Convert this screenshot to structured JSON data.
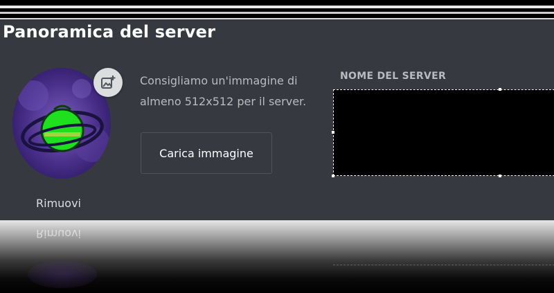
{
  "overview": {
    "title": "Panoramica del server",
    "icon_upload": {
      "remove_label": "Rimuovi",
      "hint_text": "Consigliamo un'immagine di almeno 512x512 per il server.",
      "upload_button_label": "Carica immagine"
    },
    "server_name": {
      "label": "NOME DEL SERVER",
      "value": ""
    },
    "reflection_text": "Rimuovi"
  },
  "colors": {
    "panel_bg": "#36393f",
    "text_primary": "#ffffff",
    "text_muted": "#b9bbbe",
    "button_border": "#4f545c",
    "avatar_purple": "#4a2f8a",
    "avatar_green": "#1fe01f"
  },
  "icons": {
    "upload_badge": "image-add-icon"
  }
}
